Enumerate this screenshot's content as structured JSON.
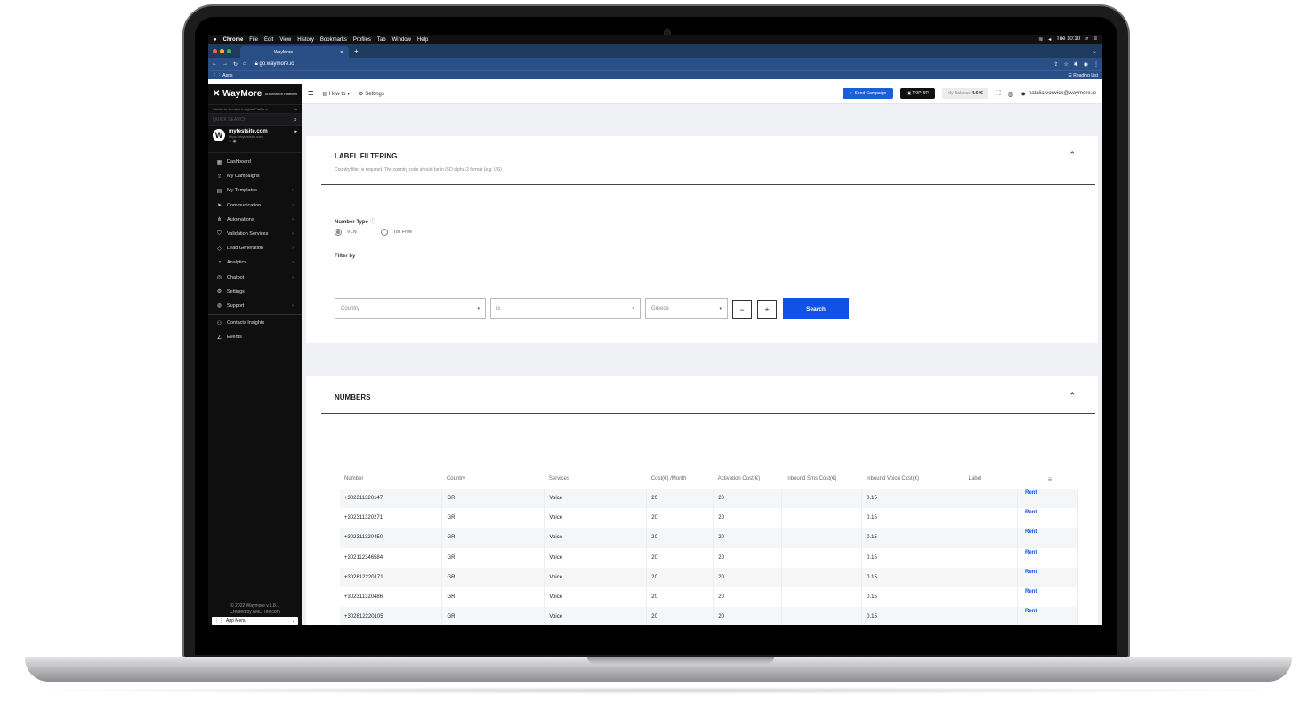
{
  "mac_menubar": {
    "items": [
      "Chrome",
      "File",
      "Edit",
      "View",
      "History",
      "Bookmarks",
      "Profiles",
      "Tab",
      "Window",
      "Help"
    ],
    "clock": "Tue 10:10"
  },
  "browser": {
    "tab_title": "WayMore",
    "url": "go.waymore.io",
    "bookmarks_apps": "Apps",
    "reading_list": "Reading List"
  },
  "sidebar": {
    "logo": "WayMore",
    "logo_sub": "Automation Platform",
    "switch_text": "Switch to Contact Insights Platform",
    "quick_search_placeholder": "QUICK SEARCH",
    "site_name": "mytestsite.com",
    "site_url": "https://mytestsite.com",
    "items": [
      {
        "label": "Dashboard",
        "icon": "dashboard-icon",
        "chevron": false
      },
      {
        "label": "My Campaigns",
        "icon": "campaigns-icon",
        "chevron": false
      },
      {
        "label": "My Templates",
        "icon": "templates-icon",
        "chevron": true
      },
      {
        "label": "Communication",
        "icon": "send-icon",
        "chevron": true
      },
      {
        "label": "Automations",
        "icon": "automations-icon",
        "chevron": true
      },
      {
        "label": "Validation Services",
        "icon": "shield-icon",
        "chevron": true
      },
      {
        "label": "Lead Generation",
        "icon": "lead-icon",
        "chevron": true
      },
      {
        "label": "Analytics",
        "icon": "analytics-icon",
        "chevron": true
      },
      {
        "label": "Chatbot",
        "icon": "chatbot-icon",
        "chevron": true
      },
      {
        "label": "Settings",
        "icon": "gear-icon",
        "chevron": false
      },
      {
        "label": "Support",
        "icon": "support-icon",
        "chevron": true
      },
      {
        "label": "Contacts Insights",
        "icon": "contacts-icon",
        "chevron": false
      },
      {
        "label": "Events",
        "icon": "events-icon",
        "chevron": false
      }
    ],
    "footer_line1": "© 2022 Waymore v.1.8.1",
    "footer_line2": "Created by AMD Telecom",
    "app_menu": "App Menu"
  },
  "header": {
    "how_to": "How to",
    "settings": "Settings",
    "send_campaign": "Send Campaign",
    "top_up": "TOP UP",
    "balance_label": "My Balance",
    "balance_value": "4.64€",
    "user_email": "natalia.vorwick@waymore.io"
  },
  "label_filtering": {
    "title": "LABEL FILTERING",
    "subtitle": "Country filter is required. The country code should be in ISO alpha-2 format (e.g. US)",
    "number_type_label": "Number Type",
    "radio_vln": "VLN",
    "radio_tollfree": "Toll Free",
    "selected_radio": "VLN",
    "filter_by_label": "Filter by",
    "filter_field": "Country",
    "filter_operator": "is",
    "filter_value": "Greece",
    "minus": "−",
    "plus": "+",
    "search_button": "Search"
  },
  "numbers": {
    "title": "NUMBERS",
    "columns": [
      "Number",
      "Country",
      "Services",
      "Cost(€) /Month",
      "Activation Cost(€)",
      "Inbound Sms Cost(€)",
      "Inbound Voice Cost(€)",
      "Label",
      ""
    ],
    "rent_label": "Rent",
    "rows": [
      {
        "number": "+302311320147",
        "country": "GR",
        "services": "Voice",
        "cost": "20",
        "activation": "20",
        "sms": "",
        "voice": "0.15",
        "label": ""
      },
      {
        "number": "+302311320271",
        "country": "GR",
        "services": "Voice",
        "cost": "20",
        "activation": "20",
        "sms": "",
        "voice": "0.15",
        "label": ""
      },
      {
        "number": "+302311320450",
        "country": "GR",
        "services": "Voice",
        "cost": "20",
        "activation": "20",
        "sms": "",
        "voice": "0.15",
        "label": ""
      },
      {
        "number": "+302112346584",
        "country": "GR",
        "services": "Voice",
        "cost": "20",
        "activation": "20",
        "sms": "",
        "voice": "0.15",
        "label": ""
      },
      {
        "number": "+302812220171",
        "country": "GR",
        "services": "Voice",
        "cost": "20",
        "activation": "20",
        "sms": "",
        "voice": "0.15",
        "label": ""
      },
      {
        "number": "+302311320486",
        "country": "GR",
        "services": "Voice",
        "cost": "20",
        "activation": "20",
        "sms": "",
        "voice": "0.15",
        "label": ""
      },
      {
        "number": "+302812220105",
        "country": "GR",
        "services": "Voice",
        "cost": "20",
        "activation": "20",
        "sms": "",
        "voice": "0.15",
        "label": ""
      }
    ]
  },
  "colors": {
    "accent": "#1152e6",
    "sidebar_bg": "#0f0f10",
    "chrome_bg": "#2a4f86"
  }
}
